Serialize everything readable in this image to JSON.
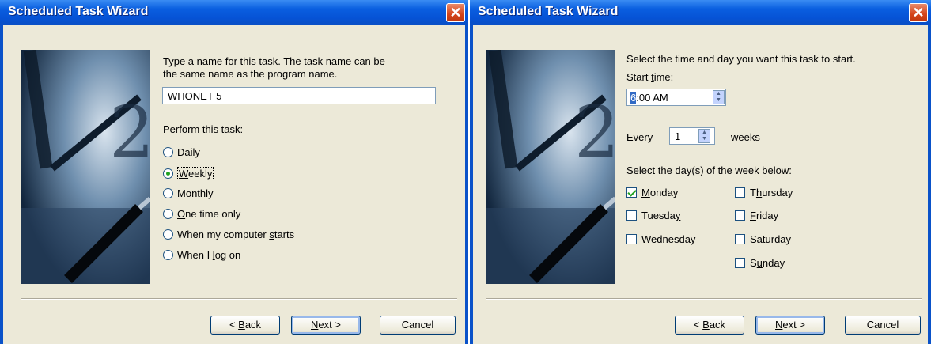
{
  "left": {
    "title": "Scheduled Task Wizard",
    "close_glyph": "✕",
    "prompt_line1_u": "T",
    "prompt_line1_rest": "ype a name for this task.  The task name can be",
    "prompt_line2": "the same name as the program name.",
    "task_name_value": "WHONET 5",
    "perform_label": "Perform this task:",
    "options": [
      {
        "u": "D",
        "rest": "aily",
        "selected": false
      },
      {
        "u": "W",
        "rest": "eekly",
        "selected": true
      },
      {
        "u": "M",
        "rest": "onthly",
        "selected": false
      },
      {
        "u": "O",
        "rest": "ne time only",
        "selected": false
      },
      {
        "pre": "When my computer ",
        "u": "s",
        "rest": "tarts",
        "selected": false
      },
      {
        "pre": "When I ",
        "u": "l",
        "rest": "og on",
        "selected": false
      }
    ],
    "back_u": "B",
    "back_pre": "< ",
    "back_rest": "ack",
    "next_u": "N",
    "next_rest": "ext >",
    "cancel": "Cancel"
  },
  "right": {
    "title": "Scheduled Task Wizard",
    "close_glyph": "✕",
    "prompt": "Select the time and day you want this task to start.",
    "start_pre": "Start ",
    "start_u": "t",
    "start_rest": "ime:",
    "time_sel": "6",
    "time_rest": ":00 AM",
    "every_u": "E",
    "every_rest": "very",
    "every_value": "1",
    "weeks": "weeks",
    "days_label": "Select the day(s) of the week below:",
    "days": [
      {
        "pre": "",
        "u": "M",
        "rest": "onday",
        "checked": true
      },
      {
        "pre": "Tuesda",
        "u": "y",
        "rest": "",
        "checked": false
      },
      {
        "pre": "",
        "u": "W",
        "rest": "ednesday",
        "checked": false
      },
      {
        "pre": "T",
        "u": "h",
        "rest": "ursday",
        "checked": false
      },
      {
        "pre": "",
        "u": "F",
        "rest": "riday",
        "checked": false
      },
      {
        "pre": "",
        "u": "S",
        "rest": "aturday",
        "checked": false
      },
      {
        "pre": "S",
        "u": "u",
        "rest": "nday",
        "checked": false
      }
    ],
    "back_u": "B",
    "back_pre": "< ",
    "back_rest": "ack",
    "next_u": "N",
    "next_rest": "ext >",
    "cancel": "Cancel"
  },
  "colors": {
    "titlebar": "#0a5fe0",
    "face": "#ece9d8",
    "close": "#d4441a",
    "check": "#21a121"
  }
}
